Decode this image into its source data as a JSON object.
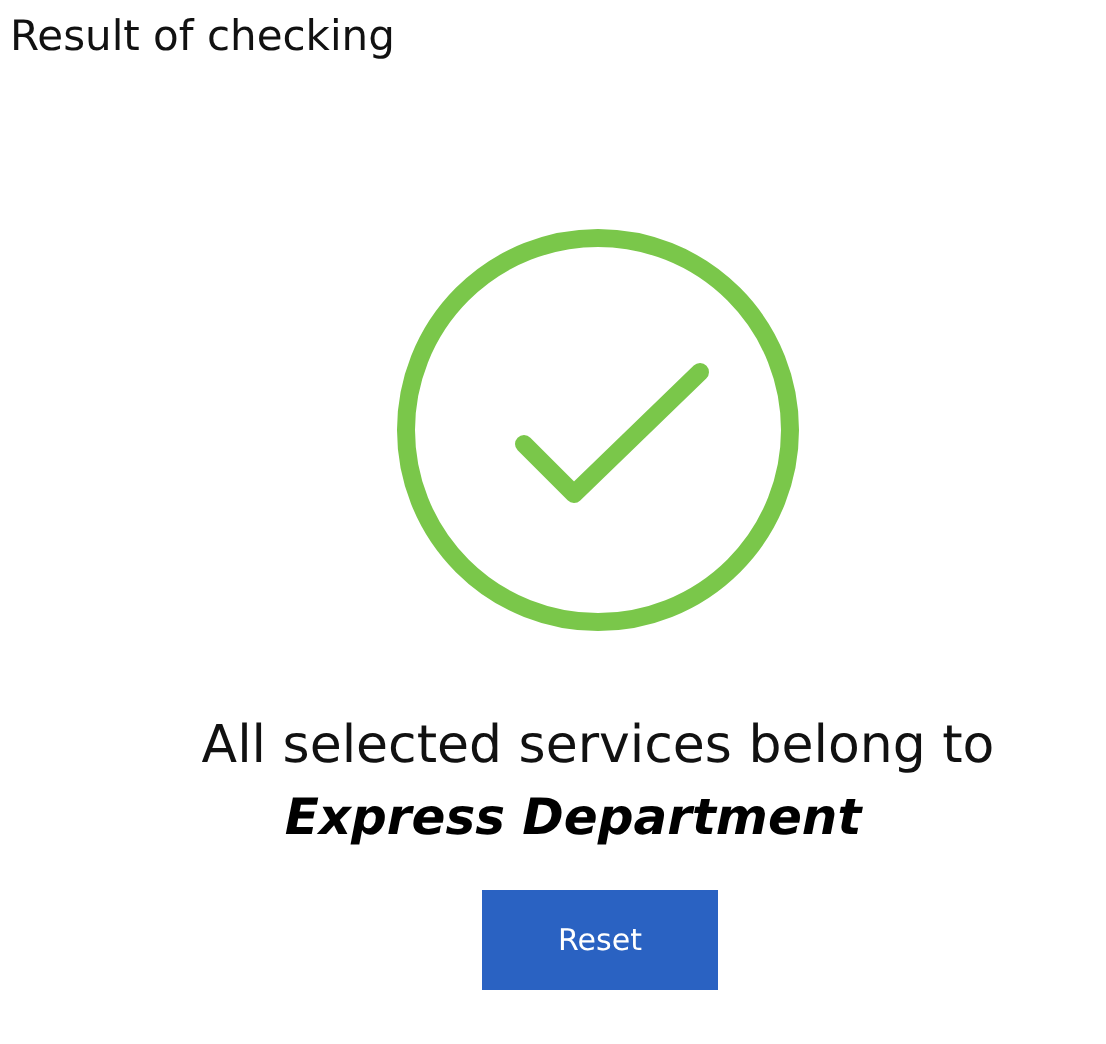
{
  "title": "Result of checking",
  "result": {
    "message": "All selected services belong to",
    "department": "Express Department"
  },
  "buttons": [
    {
      "label": "Reset"
    }
  ]
}
